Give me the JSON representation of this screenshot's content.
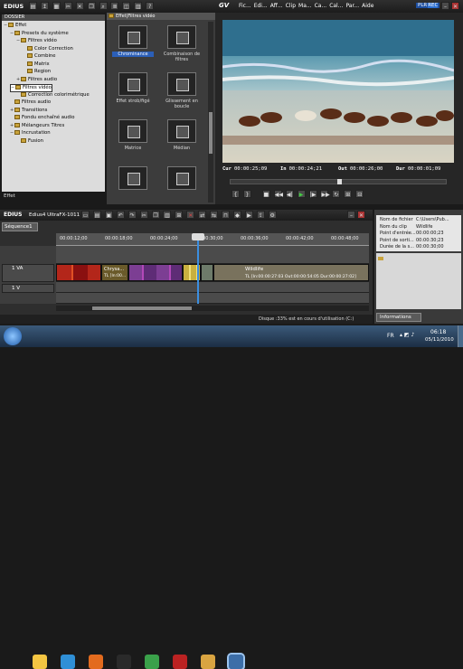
{
  "app": {
    "title": "EDIUS"
  },
  "bin": {
    "header": "DOSSIER",
    "tree": [
      {
        "label": "Effet",
        "level": 0,
        "exp": "−"
      },
      {
        "label": "Presets du système",
        "level": 1,
        "exp": "−"
      },
      {
        "label": "Filtres vidéo",
        "level": 2,
        "exp": "−"
      },
      {
        "label": "Color Correction",
        "level": 3,
        "exp": ""
      },
      {
        "label": "Combine",
        "level": 3,
        "exp": ""
      },
      {
        "label": "Matrix",
        "level": 3,
        "exp": ""
      },
      {
        "label": "Region",
        "level": 3,
        "exp": ""
      },
      {
        "label": "Filtres audio",
        "level": 2,
        "exp": "+"
      },
      {
        "label": "Filtres vidéo",
        "level": 1,
        "exp": "−",
        "selected": true
      },
      {
        "label": "Correction colorimétrique",
        "level": 2,
        "exp": ""
      },
      {
        "label": "Filtres audio",
        "level": 1,
        "exp": ""
      },
      {
        "label": "Transitions",
        "level": 1,
        "exp": "+"
      },
      {
        "label": "Fondu enchaîné audio",
        "level": 1,
        "exp": ""
      },
      {
        "label": "Mélangeurs Titres",
        "level": 1,
        "exp": "+"
      },
      {
        "label": "Incrustation",
        "level": 1,
        "exp": "−"
      },
      {
        "label": "Fusion",
        "level": 2,
        "exp": ""
      }
    ],
    "footer": "Effet"
  },
  "effects": {
    "path": "Effet|Filtres vidéo",
    "items": [
      {
        "label": "Chrominance",
        "selected": true
      },
      {
        "label": "Combinaison de filtres"
      },
      {
        "label": "Effet strob/figé"
      },
      {
        "label": "Glissement en boucle"
      },
      {
        "label": "Matrice"
      },
      {
        "label": "Médian"
      },
      {
        "label": ""
      },
      {
        "label": ""
      }
    ]
  },
  "player": {
    "logo": "GV",
    "menu": [
      "Fic...",
      "Edi...",
      "Aff...",
      "Clip",
      "Ma...",
      "Ca...",
      "Cal...",
      "Par...",
      "Aide"
    ],
    "mode": "PLR",
    "rec": "REC",
    "timecodes": [
      {
        "label": "Cur",
        "value": "00:00:25;09"
      },
      {
        "label": "In",
        "value": "00:00:24;21"
      },
      {
        "label": "Out",
        "value": "00:00:26;00"
      },
      {
        "label": "Dur",
        "value": "00:00:01;09"
      }
    ],
    "scrub_position": 0.5
  },
  "timeline": {
    "project": "Edius4 UltraFX-1011",
    "sequence": "Séquence1",
    "ruler": [
      "00:00:12;00",
      "00:00:18;00",
      "00:00:24;00",
      "00:00:30;00",
      "00:00:36;00",
      "00:00:42;00",
      "00:00:48;00"
    ],
    "tracks": [
      "1 VA",
      "1 V",
      "2 VA"
    ],
    "clip_a": {
      "name": "Chrysa...",
      "tc": "TL [In:00..."
    },
    "clip_b": {
      "name": "Wildlife",
      "tc": "TL [In:00:00:27:03 Out:00:00:54:05 Dur:00:00:27:02]"
    },
    "status": "Disque :33% est en cours d'utilisation (C:)"
  },
  "info": {
    "rows": [
      {
        "k": "Nom de fichier",
        "v": "C:\\Users\\Pub..."
      },
      {
        "k": "Nom du clip",
        "v": "Wildlife"
      },
      {
        "k": "Point d'entrée...",
        "v": "00:00:00;23"
      },
      {
        "k": "Point de sorti...",
        "v": "00:00:30;23"
      },
      {
        "k": "Durée de la s...",
        "v": "00:00:30;00"
      }
    ],
    "tab": "Informations"
  },
  "taskbar": {
    "lang": "FR",
    "time": "06:18",
    "date": "05/11/2010",
    "icons": [
      "explorer",
      "media-player",
      "firefox",
      "edius",
      "chrome",
      "dvd",
      "folder",
      "edius-active"
    ]
  },
  "colors": {
    "accent": "#2b5fb8",
    "timeline_cursor": "#d02020",
    "video_clip_a": "#a31a1a",
    "video_clip_b": "#6b3f8a"
  }
}
